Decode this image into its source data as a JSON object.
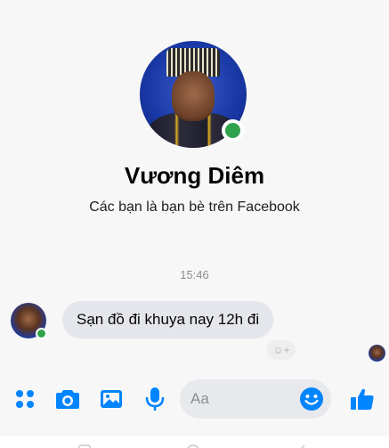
{
  "contact": {
    "name": "Vương Diêm",
    "relationship": "Các bạn là bạn bè trên Facebook",
    "status": "online"
  },
  "thread": {
    "timestamp": "15:46",
    "messages": [
      {
        "sender": "Vương Diêm",
        "text": "Sạn đồ đi khuya nay 12h đi"
      }
    ]
  },
  "composer": {
    "placeholder": "Aa",
    "buttons": [
      "more-icon",
      "camera-icon",
      "gallery-icon",
      "microphone-icon",
      "emoji-icon",
      "like-icon"
    ]
  },
  "colors": {
    "accent": "#0084ff",
    "online": "#31a24c",
    "bubble": "#e4e6eb",
    "background": "#f7f7f7"
  }
}
